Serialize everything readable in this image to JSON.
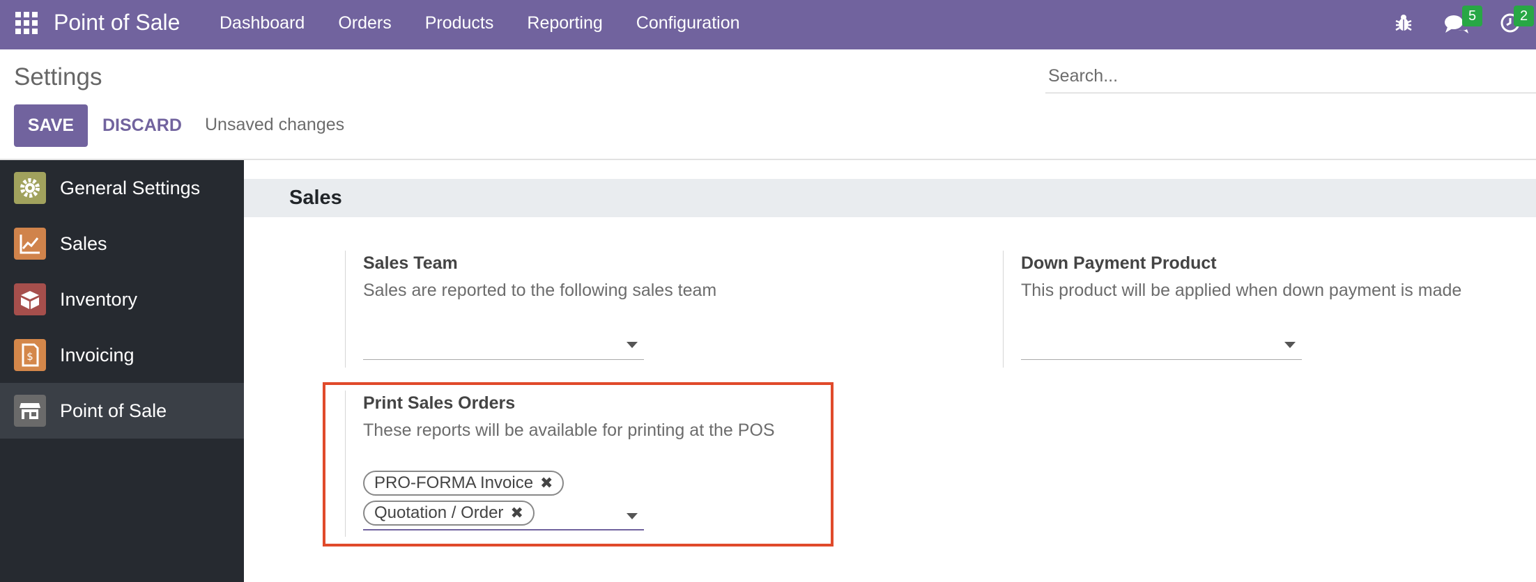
{
  "navbar": {
    "app_title": "Point of Sale",
    "menu": [
      "Dashboard",
      "Orders",
      "Products",
      "Reporting",
      "Configuration"
    ],
    "messages_count": "5",
    "activities_count": "2",
    "bg_color": "#71639e"
  },
  "control_panel": {
    "title": "Settings",
    "search_placeholder": "Search...",
    "save_label": "SAVE",
    "discard_label": "DISCARD",
    "status": "Unsaved changes"
  },
  "sidebar": {
    "items": [
      {
        "label": "General Settings",
        "icon": "gear-icon",
        "color": "#a1a25d"
      },
      {
        "label": "Sales",
        "icon": "chart-icon",
        "color": "#d0834b"
      },
      {
        "label": "Inventory",
        "icon": "box-icon",
        "color": "#a64f4c"
      },
      {
        "label": "Invoicing",
        "icon": "invoice-icon",
        "color": "#d4874a"
      },
      {
        "label": "Point of Sale",
        "icon": "store-icon",
        "color": "#6a6a6a"
      }
    ],
    "active": "Point of Sale"
  },
  "main": {
    "section_title": "Sales",
    "sales_team": {
      "title": "Sales Team",
      "description": "Sales are reported to the following sales team",
      "value": ""
    },
    "down_payment": {
      "title": "Down Payment Product",
      "description": "This product will be applied when down payment is made",
      "value": ""
    },
    "print_sales_orders": {
      "title": "Print Sales Orders",
      "description": "These reports will be available for printing at the POS",
      "tags": [
        "PRO-FORMA Invoice",
        "Quotation / Order"
      ]
    }
  },
  "highlight_color": "#e04a2b"
}
